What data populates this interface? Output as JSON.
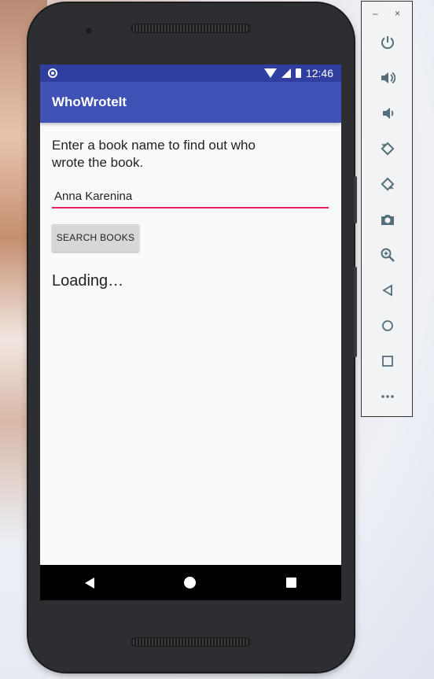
{
  "status_bar": {
    "time": "12:46"
  },
  "app": {
    "title": "WhoWroteIt"
  },
  "main": {
    "instructions": "Enter a book name to find out who wrote the book.",
    "book_input_value": "Anna Karenina",
    "search_button_label": "SEARCH BOOKS",
    "result_text": "Loading…"
  },
  "emulator_panel": {
    "minimize_label": "–",
    "close_label": "×",
    "tools": [
      "power-icon",
      "volume-up-icon",
      "volume-down-icon",
      "rotate-left-icon",
      "rotate-right-icon",
      "camera-icon",
      "zoom-icon",
      "back-icon",
      "home-icon",
      "overview-icon",
      "more-icon"
    ]
  },
  "colors": {
    "primary": "#3f51b5",
    "primary_dark": "#303f9f",
    "accent": "#e91e63"
  }
}
